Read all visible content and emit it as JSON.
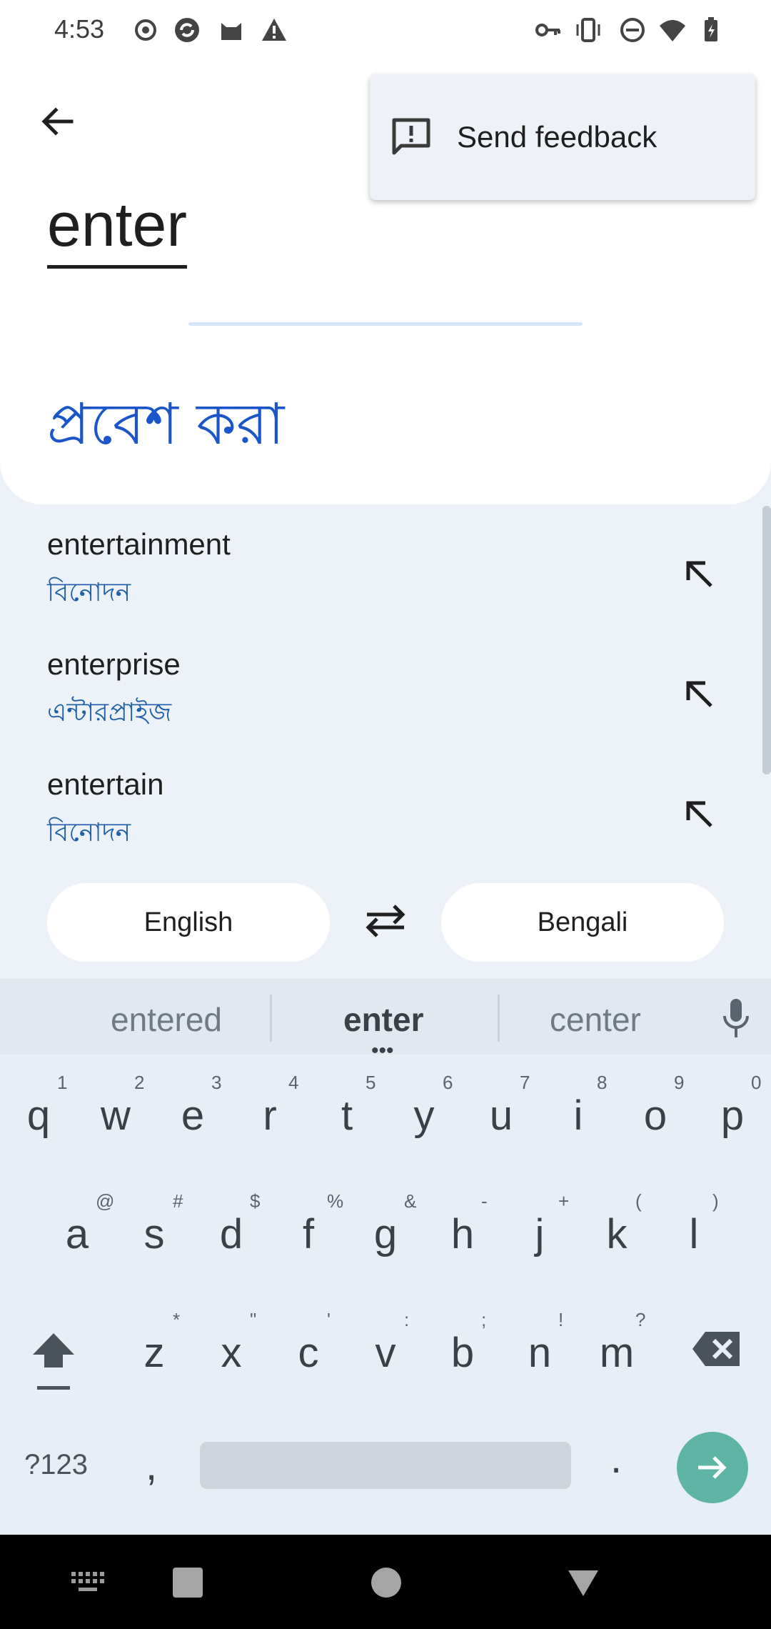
{
  "status_bar": {
    "time": "4:53",
    "left_icons": [
      "record-icon",
      "sync-icon",
      "cat-icon",
      "warning-icon"
    ],
    "right_icons": [
      "key-icon",
      "vibrate-icon",
      "dnd-icon",
      "wifi-icon",
      "battery-icon"
    ]
  },
  "header": {
    "source_text": "enter",
    "translation": "প্রবেশ করা"
  },
  "menu": {
    "items": [
      {
        "label": "Send feedback",
        "icon": "feedback-icon"
      }
    ]
  },
  "suggestions": [
    {
      "word": "entertainment",
      "translation": "বিনোদন"
    },
    {
      "word": "enterprise",
      "translation": "এন্টারপ্রাইজ"
    },
    {
      "word": "entertain",
      "translation": "বিনোদন"
    }
  ],
  "languages": {
    "source": "English",
    "target": "Bengali"
  },
  "keyboard": {
    "suggestions": [
      "entered",
      "enter",
      "center"
    ],
    "row1": [
      "q",
      "w",
      "e",
      "r",
      "t",
      "y",
      "u",
      "i",
      "o",
      "p"
    ],
    "row1_hints": [
      "1",
      "2",
      "3",
      "4",
      "5",
      "6",
      "7",
      "8",
      "9",
      "0"
    ],
    "row2": [
      "a",
      "s",
      "d",
      "f",
      "g",
      "h",
      "j",
      "k",
      "l"
    ],
    "row2_hints": [
      "@",
      "#",
      "$",
      "%",
      "&",
      "-",
      "+",
      "(",
      ")"
    ],
    "row3": [
      "z",
      "x",
      "c",
      "v",
      "b",
      "n",
      "m"
    ],
    "row3_hints": [
      "*",
      "\"",
      "'",
      ":",
      ";",
      "!",
      "?"
    ],
    "symbols_label": "?123",
    "comma": ",",
    "period": "."
  },
  "colors": {
    "translation": "#1a56c9",
    "suggestion_translation": "#1d5fa8",
    "enter_key": "#5fb5a5"
  }
}
